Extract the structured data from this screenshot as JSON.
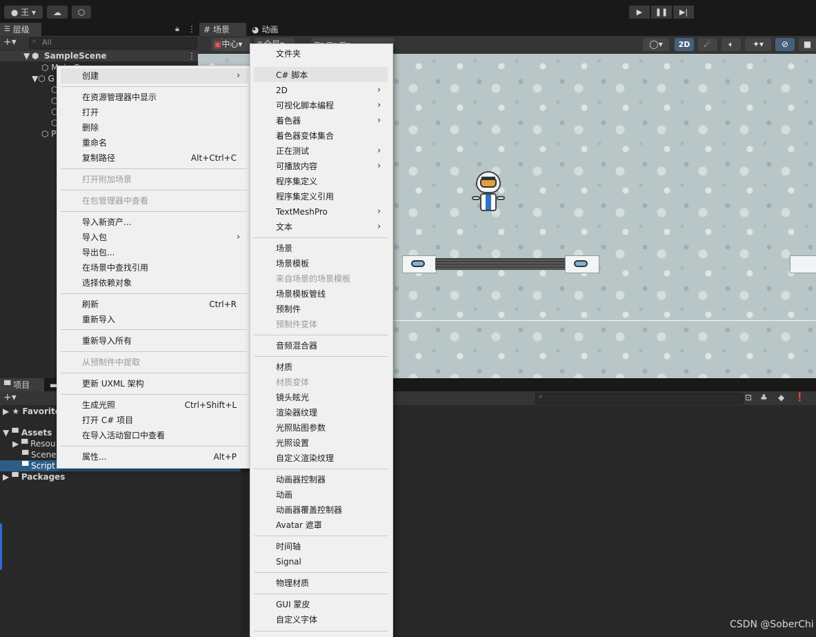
{
  "toolbar": {
    "account_label": "王",
    "play_icon": "▶",
    "pause_icon": "❚❚",
    "step_icon": "▶|"
  },
  "hierarchy": {
    "tab_label": "层级",
    "search_placeholder": "All",
    "scene_name": "SampleScene",
    "partial_rows": [
      "Main Camera",
      "G",
      "P"
    ]
  },
  "scene": {
    "tab_label": "场景",
    "anim_tab_label": "动画",
    "pivot_label": "中心",
    "space_label": "全局",
    "mode_2d": "2D"
  },
  "project": {
    "tab_label": "项目",
    "tree": [
      "Favorites",
      "Assets",
      "Resou",
      "Scene",
      "Script",
      "Packages"
    ]
  },
  "context_menu": {
    "items": [
      {
        "label": "创建",
        "submenu": true
      },
      {
        "label": "在资源管理器中显示"
      },
      {
        "label": "打开"
      },
      {
        "label": "删除"
      },
      {
        "label": "重命名"
      },
      {
        "label": "复制路径",
        "shortcut": "Alt+Ctrl+C"
      },
      {
        "label": "打开附加场景",
        "disabled": true
      },
      {
        "label": "在包管理器中查看",
        "disabled": true
      },
      {
        "label": "导入新资产..."
      },
      {
        "label": "导入包",
        "submenu": true
      },
      {
        "label": "导出包..."
      },
      {
        "label": "在场景中查找引用"
      },
      {
        "label": "选择依赖对象"
      },
      {
        "label": "刷新",
        "shortcut": "Ctrl+R"
      },
      {
        "label": "重新导入"
      },
      {
        "label": "重新导入所有"
      },
      {
        "label": "从预制件中提取",
        "disabled": true
      },
      {
        "label": "更新 UXML 架构"
      },
      {
        "label": "生成光照",
        "shortcut": "Ctrl+Shift+L"
      },
      {
        "label": "打开 C# 项目"
      },
      {
        "label": "在导入活动窗口中查看"
      },
      {
        "label": "属性...",
        "shortcut": "Alt+P"
      }
    ]
  },
  "create_submenu": {
    "items": [
      {
        "label": "文件夹"
      },
      {
        "label": "C# 脚本"
      },
      {
        "label": "2D",
        "submenu": true
      },
      {
        "label": "可视化脚本编程",
        "submenu": true
      },
      {
        "label": "着色器",
        "submenu": true
      },
      {
        "label": "着色器变体集合"
      },
      {
        "label": "正在测试",
        "submenu": true
      },
      {
        "label": "可播放内容",
        "submenu": true
      },
      {
        "label": "程序集定义"
      },
      {
        "label": "程序集定义引用"
      },
      {
        "label": "TextMeshPro",
        "submenu": true
      },
      {
        "label": "文本",
        "submenu": true
      },
      {
        "label": "场景"
      },
      {
        "label": "场景模板"
      },
      {
        "label": "来自场景的场景模板",
        "disabled": true
      },
      {
        "label": "场景模板管线"
      },
      {
        "label": "预制件"
      },
      {
        "label": "预制件变体",
        "disabled": true
      },
      {
        "label": "音频混合器"
      },
      {
        "label": "材质"
      },
      {
        "label": "材质变体",
        "disabled": true
      },
      {
        "label": "镜头眩光"
      },
      {
        "label": "渲染器纹理"
      },
      {
        "label": "光照贴图参数"
      },
      {
        "label": "光照设置"
      },
      {
        "label": "自定义渲染纹理"
      },
      {
        "label": "动画器控制器"
      },
      {
        "label": "动画"
      },
      {
        "label": "动画器覆盖控制器"
      },
      {
        "label": "Avatar 遮罩"
      },
      {
        "label": "时间轴"
      },
      {
        "label": "Signal"
      },
      {
        "label": "物理材质"
      },
      {
        "label": "GUI 蒙皮"
      },
      {
        "label": "自定义字体"
      }
    ]
  },
  "watermark": "CSDN @SoberChi",
  "colors": {
    "editor_bg": "#282828",
    "menu_bg": "#f0f0f0",
    "selection_blue": "#2c5d87",
    "scene_bg": "#b9c6c7"
  }
}
